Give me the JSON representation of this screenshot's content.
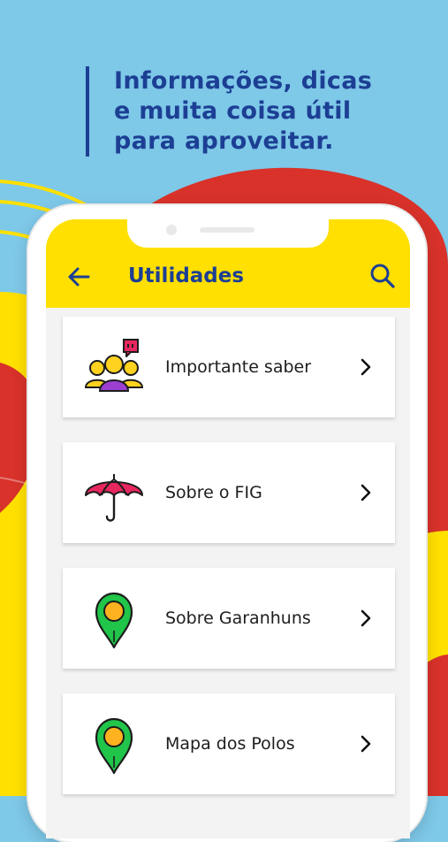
{
  "promo": {
    "line1": "Informações, dicas",
    "line2": "e muita coisa útil",
    "line3": "para aproveitar."
  },
  "appbar": {
    "title": "Utilidades",
    "back_icon": "arrow-left-icon",
    "search_icon": "search-icon"
  },
  "menu": [
    {
      "label": "Importante saber",
      "icon": "people-chat-icon"
    },
    {
      "label": "Sobre o FIG",
      "icon": "umbrella-icon"
    },
    {
      "label": "Sobre Garanhuns",
      "icon": "map-pin-icon"
    },
    {
      "label": "Mapa dos Polos",
      "icon": "map-pin-icon"
    }
  ],
  "colors": {
    "brand_blue": "#1c3f94",
    "yellow": "#ffe000",
    "sky": "#7ec8e8",
    "red": "#d8322a",
    "pink": "#e8275f",
    "green": "#20c54a",
    "purple": "#9b3fd0"
  }
}
